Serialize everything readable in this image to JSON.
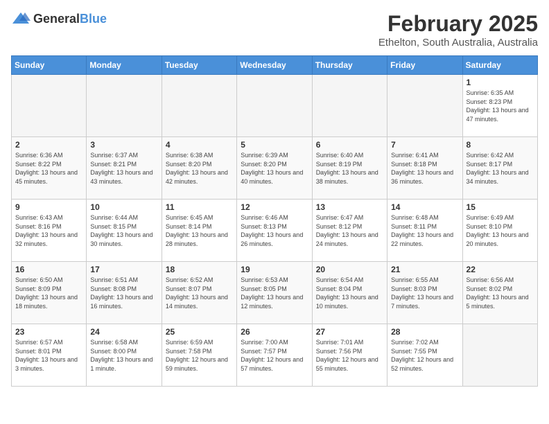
{
  "header": {
    "logo_general": "General",
    "logo_blue": "Blue",
    "title": "February 2025",
    "subtitle": "Ethelton, South Australia, Australia"
  },
  "weekdays": [
    "Sunday",
    "Monday",
    "Tuesday",
    "Wednesday",
    "Thursday",
    "Friday",
    "Saturday"
  ],
  "weeks": [
    [
      {
        "day": "",
        "info": ""
      },
      {
        "day": "",
        "info": ""
      },
      {
        "day": "",
        "info": ""
      },
      {
        "day": "",
        "info": ""
      },
      {
        "day": "",
        "info": ""
      },
      {
        "day": "",
        "info": ""
      },
      {
        "day": "1",
        "info": "Sunrise: 6:35 AM\nSunset: 8:23 PM\nDaylight: 13 hours and 47 minutes."
      }
    ],
    [
      {
        "day": "2",
        "info": "Sunrise: 6:36 AM\nSunset: 8:22 PM\nDaylight: 13 hours and 45 minutes."
      },
      {
        "day": "3",
        "info": "Sunrise: 6:37 AM\nSunset: 8:21 PM\nDaylight: 13 hours and 43 minutes."
      },
      {
        "day": "4",
        "info": "Sunrise: 6:38 AM\nSunset: 8:20 PM\nDaylight: 13 hours and 42 minutes."
      },
      {
        "day": "5",
        "info": "Sunrise: 6:39 AM\nSunset: 8:20 PM\nDaylight: 13 hours and 40 minutes."
      },
      {
        "day": "6",
        "info": "Sunrise: 6:40 AM\nSunset: 8:19 PM\nDaylight: 13 hours and 38 minutes."
      },
      {
        "day": "7",
        "info": "Sunrise: 6:41 AM\nSunset: 8:18 PM\nDaylight: 13 hours and 36 minutes."
      },
      {
        "day": "8",
        "info": "Sunrise: 6:42 AM\nSunset: 8:17 PM\nDaylight: 13 hours and 34 minutes."
      }
    ],
    [
      {
        "day": "9",
        "info": "Sunrise: 6:43 AM\nSunset: 8:16 PM\nDaylight: 13 hours and 32 minutes."
      },
      {
        "day": "10",
        "info": "Sunrise: 6:44 AM\nSunset: 8:15 PM\nDaylight: 13 hours and 30 minutes."
      },
      {
        "day": "11",
        "info": "Sunrise: 6:45 AM\nSunset: 8:14 PM\nDaylight: 13 hours and 28 minutes."
      },
      {
        "day": "12",
        "info": "Sunrise: 6:46 AM\nSunset: 8:13 PM\nDaylight: 13 hours and 26 minutes."
      },
      {
        "day": "13",
        "info": "Sunrise: 6:47 AM\nSunset: 8:12 PM\nDaylight: 13 hours and 24 minutes."
      },
      {
        "day": "14",
        "info": "Sunrise: 6:48 AM\nSunset: 8:11 PM\nDaylight: 13 hours and 22 minutes."
      },
      {
        "day": "15",
        "info": "Sunrise: 6:49 AM\nSunset: 8:10 PM\nDaylight: 13 hours and 20 minutes."
      }
    ],
    [
      {
        "day": "16",
        "info": "Sunrise: 6:50 AM\nSunset: 8:09 PM\nDaylight: 13 hours and 18 minutes."
      },
      {
        "day": "17",
        "info": "Sunrise: 6:51 AM\nSunset: 8:08 PM\nDaylight: 13 hours and 16 minutes."
      },
      {
        "day": "18",
        "info": "Sunrise: 6:52 AM\nSunset: 8:07 PM\nDaylight: 13 hours and 14 minutes."
      },
      {
        "day": "19",
        "info": "Sunrise: 6:53 AM\nSunset: 8:05 PM\nDaylight: 13 hours and 12 minutes."
      },
      {
        "day": "20",
        "info": "Sunrise: 6:54 AM\nSunset: 8:04 PM\nDaylight: 13 hours and 10 minutes."
      },
      {
        "day": "21",
        "info": "Sunrise: 6:55 AM\nSunset: 8:03 PM\nDaylight: 13 hours and 7 minutes."
      },
      {
        "day": "22",
        "info": "Sunrise: 6:56 AM\nSunset: 8:02 PM\nDaylight: 13 hours and 5 minutes."
      }
    ],
    [
      {
        "day": "23",
        "info": "Sunrise: 6:57 AM\nSunset: 8:01 PM\nDaylight: 13 hours and 3 minutes."
      },
      {
        "day": "24",
        "info": "Sunrise: 6:58 AM\nSunset: 8:00 PM\nDaylight: 13 hours and 1 minute."
      },
      {
        "day": "25",
        "info": "Sunrise: 6:59 AM\nSunset: 7:58 PM\nDaylight: 12 hours and 59 minutes."
      },
      {
        "day": "26",
        "info": "Sunrise: 7:00 AM\nSunset: 7:57 PM\nDaylight: 12 hours and 57 minutes."
      },
      {
        "day": "27",
        "info": "Sunrise: 7:01 AM\nSunset: 7:56 PM\nDaylight: 12 hours and 55 minutes."
      },
      {
        "day": "28",
        "info": "Sunrise: 7:02 AM\nSunset: 7:55 PM\nDaylight: 12 hours and 52 minutes."
      },
      {
        "day": "",
        "info": ""
      }
    ]
  ]
}
